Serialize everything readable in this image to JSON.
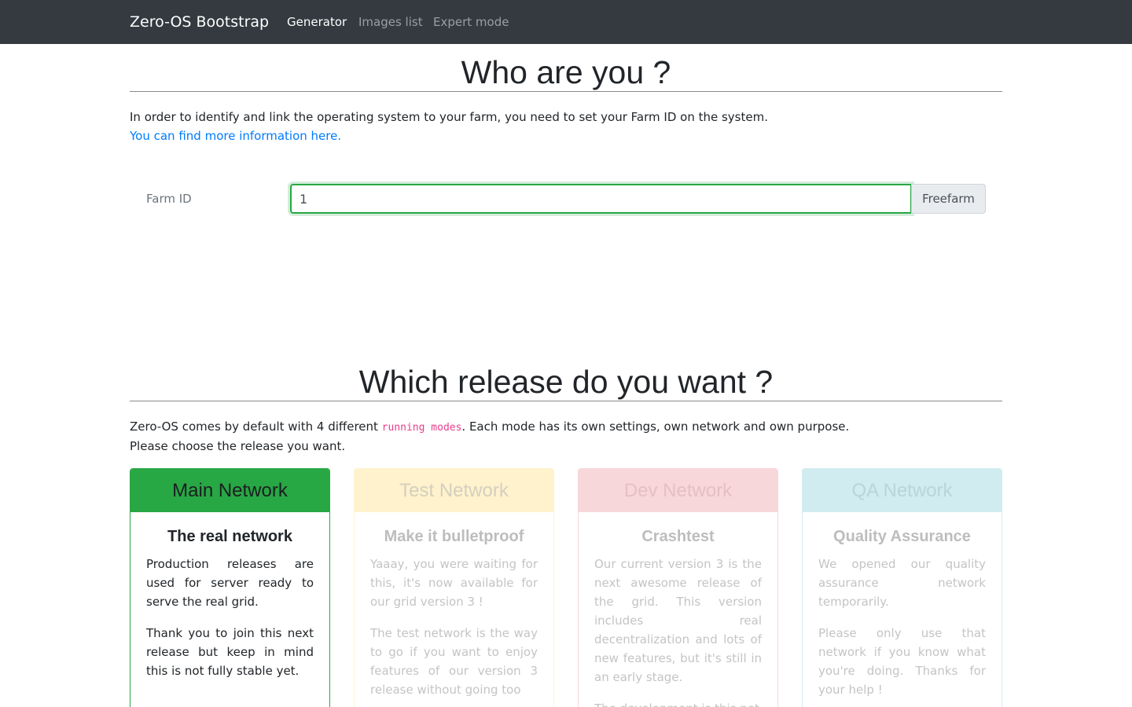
{
  "navbar": {
    "brand": "Zero-OS Bootstrap",
    "links": [
      {
        "label": "Generator",
        "active": true
      },
      {
        "label": "Images list",
        "active": false
      },
      {
        "label": "Expert mode",
        "active": false
      }
    ]
  },
  "who": {
    "title": "Who are you ?",
    "intro": "In order to identify and link the operating system to your farm, you need to set your Farm ID on the system.",
    "link_text": "You can find more information here.",
    "farm_label": "Farm ID",
    "farm_value": "1",
    "farm_name": "Freefarm"
  },
  "release": {
    "title": "Which release do you want ?",
    "text_before_code": "Zero-OS comes by default with 4 different ",
    "code": "running modes",
    "text_after_code": ". Each mode has its own settings, own network and own purpose.",
    "text_2": "Please choose the release you want.",
    "cards": [
      {
        "header": "Main Network",
        "subtitle": "The real network",
        "paragraphs": [
          "Production releases are used for server ready to serve the real grid.",
          "Thank you to join this next release but keep in mind this is not fully stable yet."
        ]
      },
      {
        "header": "Test Network",
        "subtitle": "Make it bulletproof",
        "paragraphs": [
          "Yaaay, you were waiting for this, it's now available for our grid version 3 !",
          "The test network is the way to go if you want to enjoy features of our version 3 release without going too"
        ]
      },
      {
        "header": "Dev Network",
        "subtitle": "Crashtest",
        "paragraphs": [
          "Our current version 3 is the next awesome release of the grid. This version includes real decentralization and lots of new features, but it's still in an early stage.",
          "The development is this net"
        ]
      },
      {
        "header": "QA Network",
        "subtitle": "Quality Assurance",
        "paragraphs": [
          "We opened our quality assurance network temporarily.",
          "Please only use that network if you know what you're doing. Thanks for your help !"
        ]
      }
    ]
  }
}
